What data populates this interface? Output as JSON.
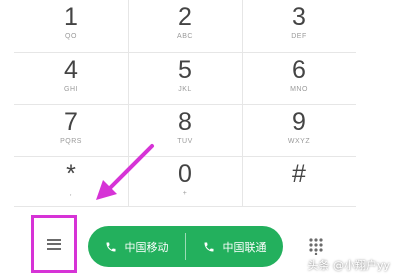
{
  "keypad": {
    "keys": [
      {
        "digit": "1",
        "letters": "QO"
      },
      {
        "digit": "2",
        "letters": "ABC"
      },
      {
        "digit": "3",
        "letters": "DEF"
      },
      {
        "digit": "4",
        "letters": "GHI"
      },
      {
        "digit": "5",
        "letters": "JKL"
      },
      {
        "digit": "6",
        "letters": "MNO"
      },
      {
        "digit": "7",
        "letters": "PQRS"
      },
      {
        "digit": "8",
        "letters": "TUV"
      },
      {
        "digit": "9",
        "letters": "WXYZ"
      },
      {
        "digit": "*",
        "letters": ","
      },
      {
        "digit": "0",
        "letters": "+"
      },
      {
        "digit": "#",
        "letters": ""
      }
    ]
  },
  "bottom_bar": {
    "menu_icon": "hamburger-menu-icon",
    "call_buttons": [
      {
        "label": "中国移动",
        "icon": "phone-icon"
      },
      {
        "label": "中国联通",
        "icon": "phone-icon"
      }
    ],
    "dialpad_icon": "dialpad-grid-icon"
  },
  "annotation": {
    "highlight_color": "#d633d6",
    "arrow_color": "#d633d6"
  },
  "colors": {
    "call_green": "#23b05d",
    "digit_text": "#444444"
  },
  "watermark": "头条 @小翔户yy"
}
